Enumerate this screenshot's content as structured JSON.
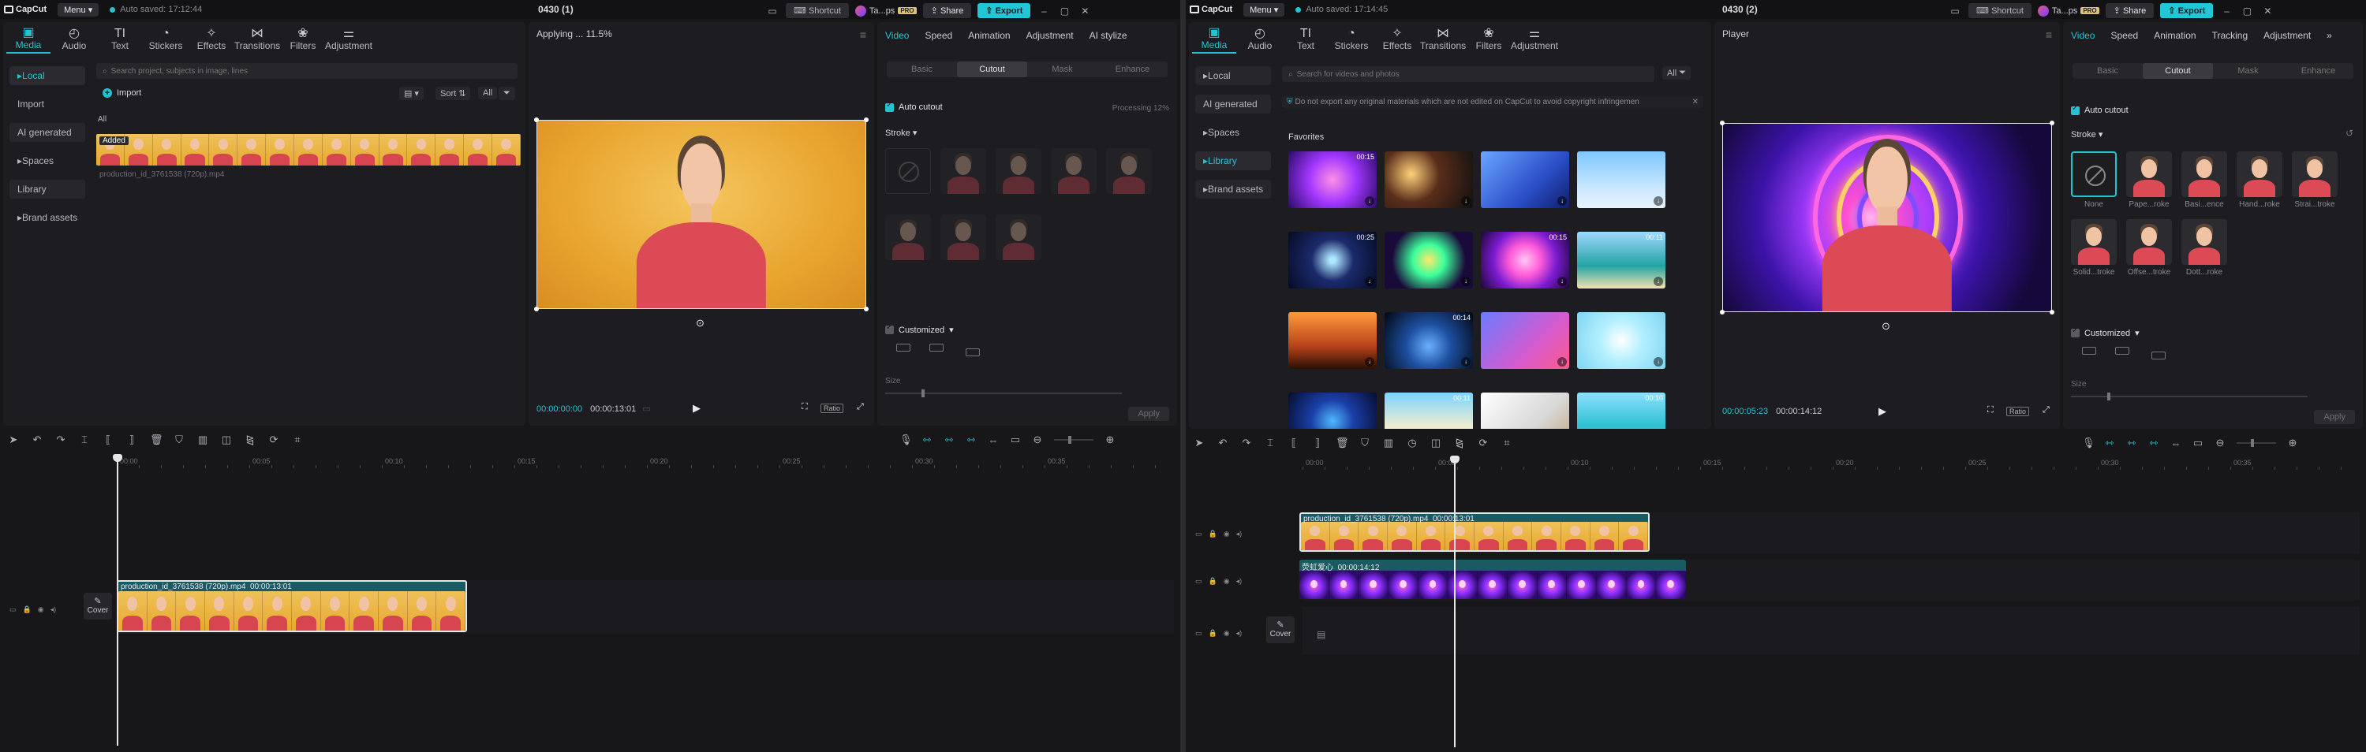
{
  "left": {
    "app_name": "CapCut",
    "menu_label": "Menu",
    "autosave": "Auto saved: 17:12:44",
    "project_title": "0430 (1)",
    "shortcut": "Shortcut",
    "user": "Ta...ps",
    "pro_badge": "PRO",
    "share": "Share",
    "export": "Export",
    "tools": [
      "Media",
      "Audio",
      "Text",
      "Stickers",
      "Effects",
      "Transitions",
      "Filters",
      "Adjustment"
    ],
    "nav": [
      "Local",
      "Import",
      "AI generated",
      "Spaces",
      "Library",
      "Brand assets"
    ],
    "search_placeholder": "Search project, subjects in image, lines",
    "import_label": "Import",
    "sort_label": "Sort",
    "all_label": "All",
    "all_heading": "All",
    "added_badge": "Added",
    "media_file": "production_id_3761538 (720p).mp4",
    "preview_status": "Applying ... 11.5%",
    "time_current": "00:00:00:00",
    "time_total": "00:00:13:01",
    "ratio_label": "Ratio",
    "right_tabs": [
      "Video",
      "Speed",
      "Animation",
      "Adjustment",
      "AI stylize"
    ],
    "segments": [
      "Basic",
      "Cutout",
      "Mask",
      "Enhance"
    ],
    "auto_cutout": "Auto cutout",
    "processing": "Processing 12%",
    "stroke": "Stroke",
    "customized": "Customized",
    "size_label": "Size",
    "apply": "Apply",
    "ruler": [
      "00:00",
      "00:05",
      "00:10",
      "00:15",
      "00:20",
      "00:25",
      "00:30",
      "00:35"
    ],
    "clip_label": "production_id_3761538 (720p).mp4",
    "clip_duration": "00:00:13:01",
    "cover_label": "Cover"
  },
  "right": {
    "app_name": "CapCut",
    "menu_label": "Menu",
    "autosave": "Auto saved: 17:14:45",
    "project_title": "0430 (2)",
    "shortcut": "Shortcut",
    "user": "Ta...ps",
    "pro_badge": "PRO",
    "share": "Share",
    "export": "Export",
    "tools": [
      "Media",
      "Audio",
      "Text",
      "Stickers",
      "Effects",
      "Filters",
      "Transitions",
      "Filters",
      "Adjustment"
    ],
    "tools_display": [
      "Media",
      "Audio",
      "Text",
      "Stickers",
      "Effects",
      "Transitions",
      "Filters",
      "Adjustment"
    ],
    "nav": [
      "Local",
      "AI generated",
      "Spaces",
      "Library",
      "Brand assets"
    ],
    "search_placeholder": "Search for videos and photos",
    "all_label": "All",
    "notice": "Do not export any original materials which are not edited on CapCut to avoid copyright infringemen",
    "favorites": "Favorites",
    "thumb_durations": [
      "00:15",
      "",
      "",
      "",
      "00:25",
      "",
      "00:15",
      "00:11",
      "",
      "00:14",
      "",
      "",
      "",
      "00:11",
      "",
      "00:10"
    ],
    "player_title": "Player",
    "time_current": "00:00:05:23",
    "time_total": "00:00:14:12",
    "ratio_label": "Ratio",
    "right_tabs": [
      "Video",
      "Speed",
      "Animation",
      "Tracking",
      "Adjustment"
    ],
    "segments": [
      "Basic",
      "Cutout",
      "Mask",
      "Enhance"
    ],
    "auto_cutout": "Auto cutout",
    "stroke": "Stroke",
    "stroke_labels": [
      "None",
      "Pape...roke",
      "Basi...ence",
      "Hand...roke",
      "Strai...troke",
      "Solid...troke",
      "Offse...troke",
      "Dott...roke"
    ],
    "customized": "Customized",
    "size_label": "Size",
    "apply": "Apply",
    "ruler": [
      "00:00",
      "00:05",
      "00:10",
      "00:15",
      "00:20",
      "00:25",
      "00:30",
      "00:35"
    ],
    "clip1_label": "production_id_3761538 (720p).mp4",
    "clip1_duration": "00:00:13:01",
    "clip2_label": "荧虹爱心",
    "clip2_duration": "00:00:14:12",
    "cover_label": "Cover"
  },
  "colors": {
    "accent": "#22c4d4",
    "background": "#17171a",
    "panel": "#1d1d21"
  }
}
